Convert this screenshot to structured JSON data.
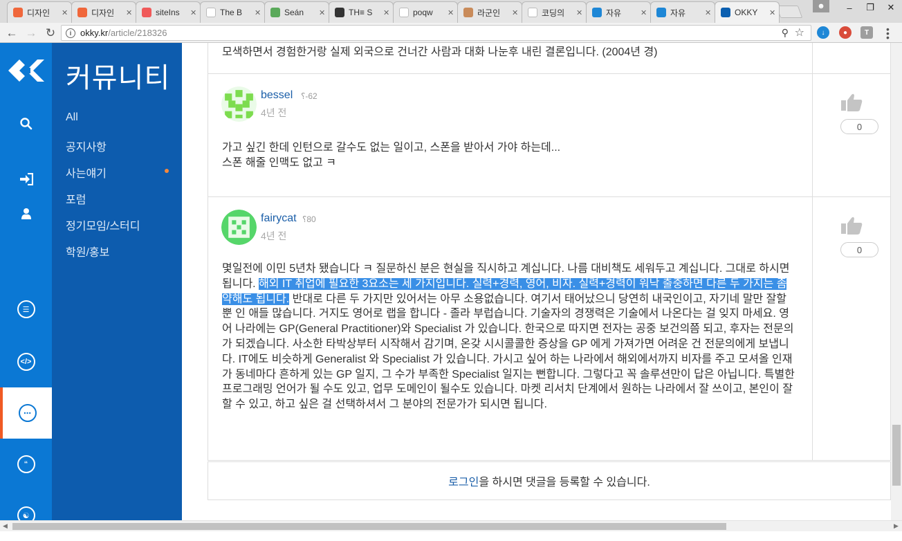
{
  "browser": {
    "tabs": [
      {
        "label": "디자인",
        "favicon": "orange-circle-icon",
        "color": "#f0673b"
      },
      {
        "label": "디자인",
        "favicon": "orange-circle-icon",
        "color": "#f0673b"
      },
      {
        "label": "siteIns",
        "favicon": "red-circle-icon",
        "color": "#f05a5a"
      },
      {
        "label": "The B",
        "favicon": "b-icon",
        "color": "#ffffff"
      },
      {
        "label": "Seán",
        "favicon": "gift-icon",
        "color": "#5aa95a"
      },
      {
        "label": "TH≡ S",
        "favicon": "th-icon",
        "color": "#333333"
      },
      {
        "label": "poqw",
        "favicon": "doc-icon",
        "color": "#ffffff"
      },
      {
        "label": "라군인",
        "favicon": "face-icon",
        "color": "#c98b5a"
      },
      {
        "label": "코딩의",
        "favicon": "google-icon",
        "color": "#ffffff"
      },
      {
        "label": "자유",
        "favicon": "n-icon",
        "color": "#1e87d6"
      },
      {
        "label": "자유",
        "favicon": "n-icon",
        "color": "#1e87d6"
      },
      {
        "label": "OKKY",
        "favicon": "okky-icon",
        "color": "#0b5fb0"
      }
    ],
    "url_host": "okky.kr",
    "url_path": "/article/218326"
  },
  "rail": {
    "icons": [
      "search-icon",
      "sign-in-icon",
      "user-icon",
      "database-icon",
      "code-icon",
      "comments-icon",
      "quote-icon",
      "group-icon"
    ]
  },
  "subnav": {
    "title": "커뮤니티",
    "items": [
      "All",
      "공지사항",
      "사는얘기",
      "포럼",
      "정기모임/스터디",
      "학원/홍보"
    ]
  },
  "comments": {
    "prev_tail": "모색하면서 경험한거랑 실제 외국으로 건너간 사람과 대화 나눈후 내린 결론입니다. (2004년 경)",
    "c1": {
      "user": "bessel",
      "rep": "-62",
      "time": "4년 전",
      "line1": "가고 싶긴 한데 인턴으로 갈수도 없는 일이고, 스폰을 받아서 가야 하는데...",
      "line2": "스폰 해줄 인맥도 없고 ㅋ",
      "votes": "0"
    },
    "c2": {
      "user": "fairycat",
      "rep": "80",
      "time": "4년 전",
      "votes": "0",
      "pre": "몇일전에 이민 5년차 됐습니다 ㅋ 질문하신 분은 현실을 직시하고 계십니다. 나름 대비책도 세워두고 계십니다. 그대로 하시면 됩니다. ",
      "highlight": "해외 IT 취업에 필요한 3요소는 세 가지입니다. 실력+경력, 영어, 비자. 실력+경력이 워낙 출중하면 다른 두 가지는 좀 약해도 됩니다.",
      "post": " 반대로 다른 두 가지만 있어서는 아무 소용없습니다. 여기서 태어났으니 당연히 내국인이고, 자기네 말만 잘할 뿐 인 애들 많습니다. 거지도 영어로 랩을 합니다 - 졸라 부럽습니다. 기술자의 경쟁력은 기술에서 나온다는 걸 잊지 마세요. 영어 나라에는 GP(General Practitioner)와 Specialist 가 있습니다. 한국으로 따지면 전자는 공중 보건의쯤 되고, 후자는 전문의가 되겠습니다. 사소한 타박상부터 시작해서 감기며, 온갖 시시콜콜한 증상을 GP 에게 가져가면 어려운 건 전문의에게 보냅니다. IT에도 비슷하게 Generalist 와 Specialist 가 있습니다. 가시고 싶어 하는 나라에서 해외에서까지 비자를 주고 모셔올 인재가 동네마다 흔하게 있는 GP 일지, 그 수가 부족한 Specialist 일지는 뻔합니다. 그렇다고 꼭 솔루션만이 답은 아닙니다. 특별한 프로그래밍 언어가 될 수도 있고, 업무 도메인이 될수도 있습니다. 마켓 리서치 단계에서 원하는 나라에서 잘 쓰이고, 본인이 잘 할 수 있고, 하고 싶은 걸 선택하셔서 그 분야의 전문가가 되시면 됩니다."
    }
  },
  "login_bar": {
    "link": "로그인",
    "rest": "을 하시면 댓글을 등록할 수 있습니다."
  }
}
